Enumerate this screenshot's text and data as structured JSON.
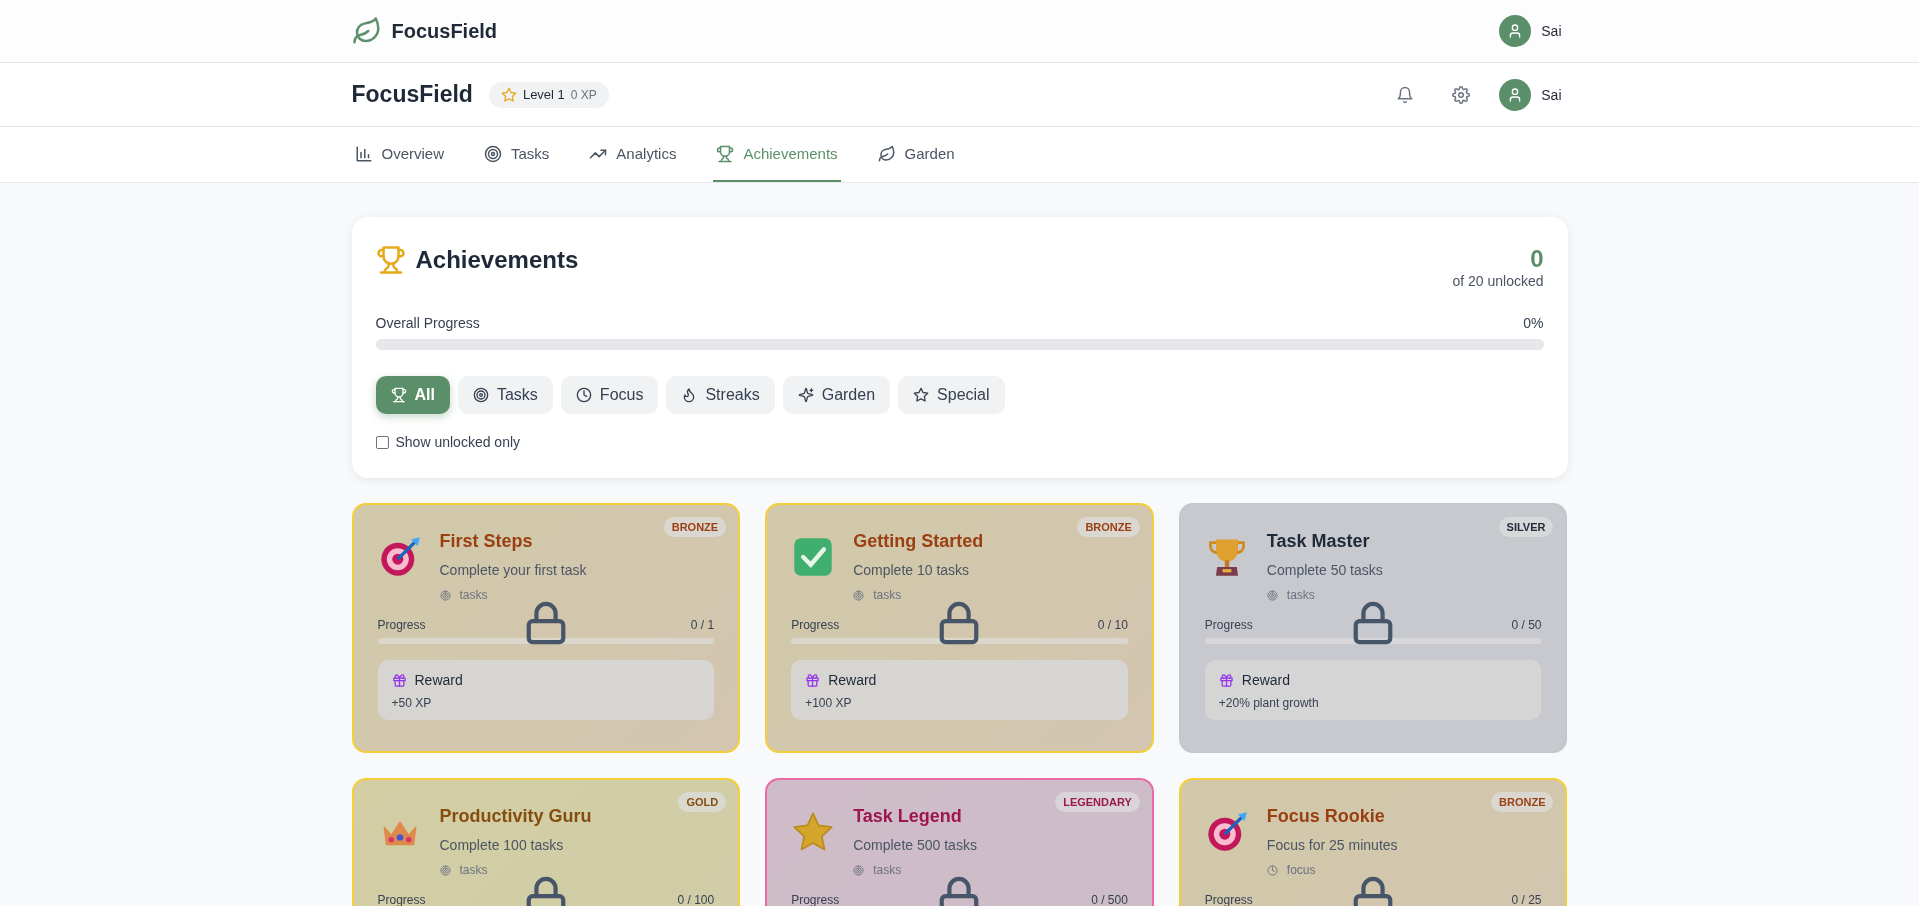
{
  "top_bar": {
    "brand": "FocusField",
    "user": "Sai"
  },
  "header": {
    "title": "FocusField",
    "level": "Level 1",
    "xp": "0 XP",
    "user": "Sai"
  },
  "tabs": [
    {
      "label": "Overview",
      "selected": false
    },
    {
      "label": "Tasks",
      "selected": false
    },
    {
      "label": "Analytics",
      "selected": false
    },
    {
      "label": "Achievements",
      "selected": true
    },
    {
      "label": "Garden",
      "selected": false
    }
  ],
  "panel": {
    "title": "Achievements",
    "unlocked_count": "0",
    "unlocked_caption": "of 20 unlocked",
    "progress_label": "Overall Progress",
    "progress_reading": "0%",
    "level": 0,
    "filters": [
      {
        "label": "All",
        "selected": true
      },
      {
        "label": "Tasks",
        "selected": false
      },
      {
        "label": "Focus",
        "selected": false
      },
      {
        "label": "Streaks",
        "selected": false
      },
      {
        "label": "Garden",
        "selected": false
      },
      {
        "label": "Special",
        "selected": false
      }
    ],
    "show_unlocked_only": {
      "label": "Show unlocked only",
      "checked": false
    }
  },
  "achievements": [
    {
      "title": "First Steps",
      "description": "Complete your first task",
      "category": "tasks",
      "tier": "BRONZE",
      "kind": "bronze",
      "locked": true,
      "progress_label": "Progress",
      "progress_reading": "0 / 1",
      "level": 0,
      "reward_label": "Reward",
      "reward": "+50 XP"
    },
    {
      "title": "Getting Started",
      "description": "Complete 10 tasks",
      "category": "tasks",
      "tier": "BRONZE",
      "kind": "bronze",
      "locked": true,
      "progress_label": "Progress",
      "progress_reading": "0 / 10",
      "level": 0,
      "reward_label": "Reward",
      "reward": "+100 XP"
    },
    {
      "title": "Task Master",
      "description": "Complete 50 tasks",
      "category": "tasks",
      "tier": "SILVER",
      "kind": "silver",
      "locked": true,
      "progress_label": "Progress",
      "progress_reading": "0 / 50",
      "level": 0,
      "reward_label": "Reward",
      "reward": "+20% plant growth"
    },
    {
      "title": "Productivity Guru",
      "description": "Complete 100 tasks",
      "category": "tasks",
      "tier": "GOLD",
      "kind": "gold",
      "locked": true,
      "progress_label": "Progress",
      "progress_reading": "0 / 100"
    },
    {
      "title": "Task Legend",
      "description": "Complete 500 tasks",
      "category": "tasks",
      "tier": "LEGENDARY",
      "kind": "legendary",
      "locked": true,
      "progress_label": "Progress",
      "progress_reading": "0 / 500"
    },
    {
      "title": "Focus Rookie",
      "description": "Focus for 25 minutes",
      "category": "focus",
      "tier": "BRONZE",
      "kind": "bronze",
      "locked": true,
      "progress_label": "Progress",
      "progress_reading": "0 / 25"
    }
  ]
}
